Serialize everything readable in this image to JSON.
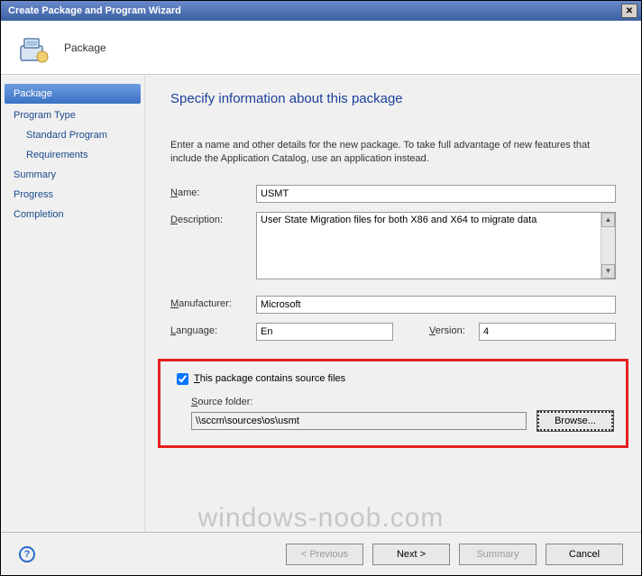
{
  "window": {
    "title": "Create Package and Program Wizard"
  },
  "banner": {
    "title": "Package"
  },
  "sidebar": {
    "items": [
      {
        "label": "Package",
        "active": true
      },
      {
        "label": "Program Type"
      },
      {
        "label": "Standard Program",
        "sub": true
      },
      {
        "label": "Requirements",
        "sub": true
      },
      {
        "label": "Summary"
      },
      {
        "label": "Progress"
      },
      {
        "label": "Completion"
      }
    ]
  },
  "main": {
    "heading": "Specify information about this package",
    "instruction": "Enter a name and other details for the new package. To take full advantage of new features that include the Application Catalog, use an application instead.",
    "labels": {
      "name": "Name:",
      "description": "Description:",
      "manufacturer": "Manufacturer:",
      "language": "Language:",
      "version": "Version:"
    },
    "fields": {
      "name": "USMT",
      "description": "User State Migration files for both X86 and X64 to migrate data",
      "manufacturer": "Microsoft",
      "language": "En",
      "version": "4"
    },
    "source": {
      "checkbox_label": "This package contains source files",
      "checked": true,
      "folder_label": "Source folder:",
      "folder_path": "\\\\sccm\\sources\\os\\usmt",
      "browse_label": "Browse..."
    }
  },
  "buttons": {
    "previous": "< Previous",
    "next": "Next >",
    "summary": "Summary",
    "cancel": "Cancel"
  },
  "watermark": "windows-noob.com"
}
